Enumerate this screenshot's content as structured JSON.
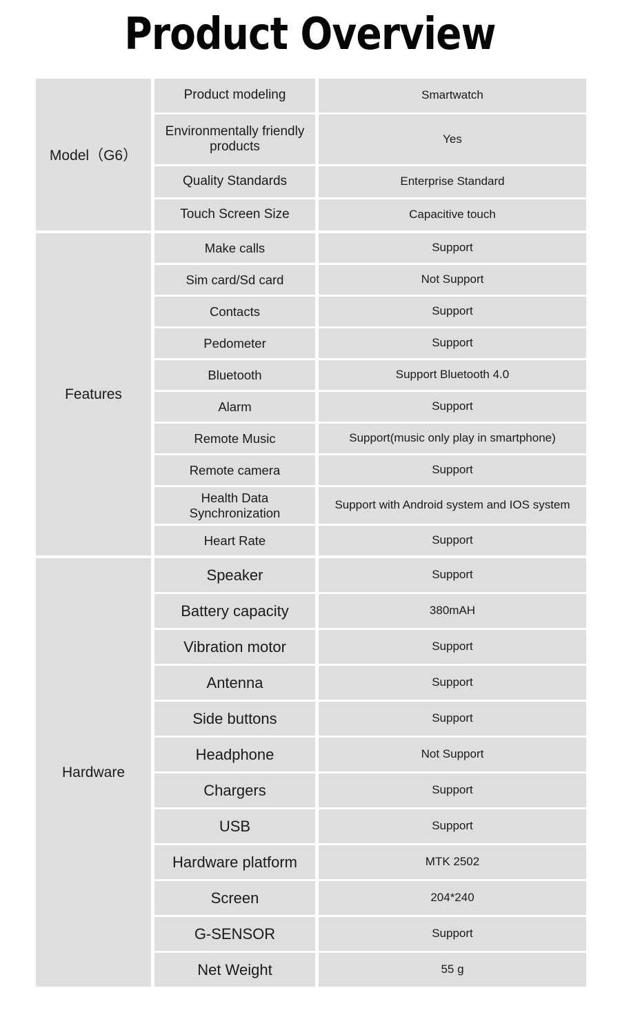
{
  "title": "Product Overview",
  "table": {
    "sections": [
      {
        "id": "model",
        "label": "Model（G6）",
        "rows": [
          {
            "label": "Product modeling",
            "value": "Smartwatch"
          },
          {
            "label": "Environmentally friendly products",
            "value": "Yes"
          },
          {
            "label": "Quality Standards",
            "value": "Enterprise Standard"
          },
          {
            "label": "Touch Screen Size",
            "value": "Capacitive touch"
          }
        ]
      },
      {
        "id": "features",
        "label": "Features",
        "rows": [
          {
            "label": "Make calls",
            "value": "Support"
          },
          {
            "label": "Sim card/Sd card",
            "value": "Not Support"
          },
          {
            "label": "Contacts",
            "value": "Support"
          },
          {
            "label": "Pedometer",
            "value": "Support"
          },
          {
            "label": "Bluetooth",
            "value": "Support Bluetooth 4.0"
          },
          {
            "label": "Alarm",
            "value": "Support"
          },
          {
            "label": "Remote Music",
            "value": "Support(music only play in smartphone)"
          },
          {
            "label": "Remote camera",
            "value": "Support"
          },
          {
            "label": "Health Data Synchronization",
            "value": "Support with Android system and IOS system"
          },
          {
            "label": "Heart Rate",
            "value": "Support"
          }
        ]
      },
      {
        "id": "hardware",
        "label": "Hardware",
        "rows": [
          {
            "label": "Speaker",
            "value": "Support"
          },
          {
            "label": "Battery capacity",
            "value": "380mAH"
          },
          {
            "label": "Vibration motor",
            "value": "Support"
          },
          {
            "label": "Antenna",
            "value": "Support"
          },
          {
            "label": "Side buttons",
            "value": "Support"
          },
          {
            "label": "Headphone",
            "value": "Not Support"
          },
          {
            "label": "Chargers",
            "value": "Support"
          },
          {
            "label": "USB",
            "value": "Support"
          },
          {
            "label": "Hardware platform",
            "value": "MTK 2502"
          },
          {
            "label": "Screen",
            "value": "204*240"
          },
          {
            "label": "G-SENSOR",
            "value": "Support"
          },
          {
            "label": "Net Weight",
            "value": "55 g"
          }
        ]
      }
    ]
  },
  "colors": {
    "cell_background": "#dedede",
    "page_background": "#ffffff",
    "text": "#1a1a1a",
    "title": "#050505"
  }
}
